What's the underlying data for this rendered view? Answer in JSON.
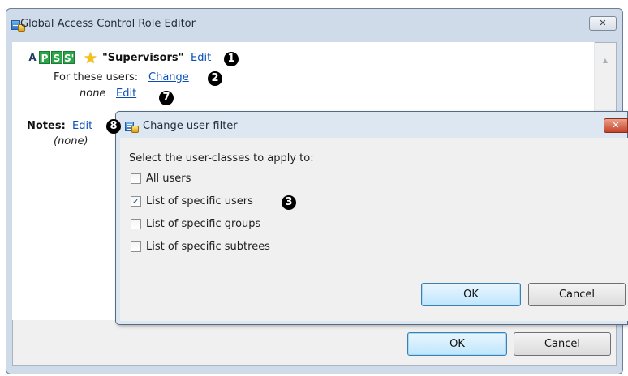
{
  "outer_window": {
    "title": "Global Access Control Role Editor",
    "close_glyph": "✕"
  },
  "role": {
    "badges": [
      "A",
      "P",
      "S",
      "S'"
    ],
    "name": "\"Supervisors\"",
    "edit_label": "Edit",
    "for_users_label": "For these users:",
    "change_label": "Change",
    "none_label": "none",
    "none_edit_label": "Edit"
  },
  "notes": {
    "label": "Notes:",
    "edit_label": "Edit",
    "value": "(none)"
  },
  "callouts": {
    "c1": "❶",
    "c2": "❷",
    "c3": "❸",
    "c7": "❼",
    "c8": "❽"
  },
  "dialog": {
    "title": "Change user filter",
    "close_glyph": "✕",
    "prompt": "Select the user-classes to apply to:",
    "options": [
      {
        "label": "All users",
        "checked": false
      },
      {
        "label": "List of specific users",
        "checked": true
      },
      {
        "label": "List of specific groups",
        "checked": false
      },
      {
        "label": "List of specific subtrees",
        "checked": false
      }
    ],
    "ok_label": "OK",
    "cancel_label": "Cancel"
  },
  "outer_buttons": {
    "ok_label": "OK",
    "cancel_label": "Cancel"
  },
  "icons": {
    "app": "role-editor-icon",
    "star": "star-icon",
    "scroll_up": "scroll-up-arrow-icon"
  },
  "colors": {
    "link": "#0a4fb8",
    "badge_green": "#2aa54a",
    "window_frame": "#cfdbe9",
    "dialog_close": "#c5432a"
  }
}
